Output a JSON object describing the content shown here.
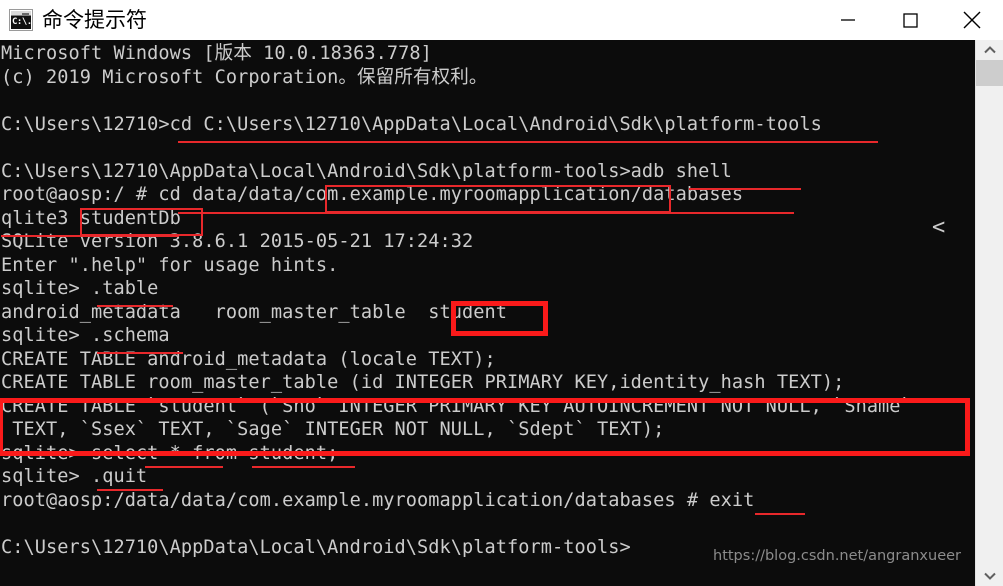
{
  "window": {
    "title": "命令提示符",
    "icon_name": "cmd-icon",
    "icon_text": "C:\\.",
    "controls": {
      "minimize_label": "Minimize",
      "maximize_label": "Maximize",
      "close_label": "Close"
    }
  },
  "terminal": {
    "background": "#0c0c0c",
    "foreground": "#cccccc",
    "annotation_color": "#e8282b",
    "highlight_color": "#fa1a1a",
    "stray_glyph": "<",
    "lines": [
      "Microsoft Windows [版本 10.0.18363.778]",
      "(c) 2019 Microsoft Corporation。保留所有权利。",
      "",
      "C:\\Users\\12710>cd C:\\Users\\12710\\AppData\\Local\\Android\\Sdk\\platform-tools",
      "",
      "C:\\Users\\12710\\AppData\\Local\\Android\\Sdk\\platform-tools>adb shell",
      "root@aosp:/ # cd data/data/com.example.myroomapplication/databases",
      "qlite3 studentDb",
      "SQLite version 3.8.6.1 2015-05-21 17:24:32",
      "Enter \".help\" for usage hints.",
      "sqlite> .table",
      "android_metadata   room_master_table  student",
      "sqlite> .schema",
      "CREATE TABLE android_metadata (locale TEXT);",
      "CREATE TABLE room_master_table (id INTEGER PRIMARY KEY,identity_hash TEXT);",
      "CREATE TABLE `student` (`Sno` INTEGER PRIMARY KEY AUTOINCREMENT NOT NULL, `Sname`",
      " TEXT, `Ssex` TEXT, `Sage` INTEGER NOT NULL, `Sdept` TEXT);",
      "sqlite> select * from student;",
      "sqlite> .quit",
      "root@aosp:/data/data/com.example.myroomapplication/databases # exit",
      "",
      "C:\\Users\\12710\\AppData\\Local\\Android\\Sdk\\platform-tools>"
    ],
    "annotations": [
      {
        "name": "underline-cd-platform-tools",
        "type": "underline"
      },
      {
        "name": "underline-adb-shell",
        "type": "underline"
      },
      {
        "name": "underline-cd-databases",
        "type": "underline"
      },
      {
        "name": "box-package-name",
        "type": "box-thin"
      },
      {
        "name": "underline-sqlite3",
        "type": "underline"
      },
      {
        "name": "box-studentdb",
        "type": "box-thin"
      },
      {
        "name": "underline-dot-table",
        "type": "underline"
      },
      {
        "name": "box-student-table",
        "type": "box-thick"
      },
      {
        "name": "underline-dot-schema",
        "type": "underline"
      },
      {
        "name": "box-create-table-student",
        "type": "box-thick"
      },
      {
        "name": "underline-select-from",
        "type": "underline"
      },
      {
        "name": "underline-student-keyword",
        "type": "underline"
      },
      {
        "name": "underline-dot-quit",
        "type": "underline"
      },
      {
        "name": "underline-exit",
        "type": "underline"
      }
    ]
  },
  "watermark": {
    "text": "https://blog.csdn.net/angranxueer"
  },
  "scrollbar": {
    "up_arrow": "scroll-up",
    "down_arrow": "scroll-down"
  }
}
